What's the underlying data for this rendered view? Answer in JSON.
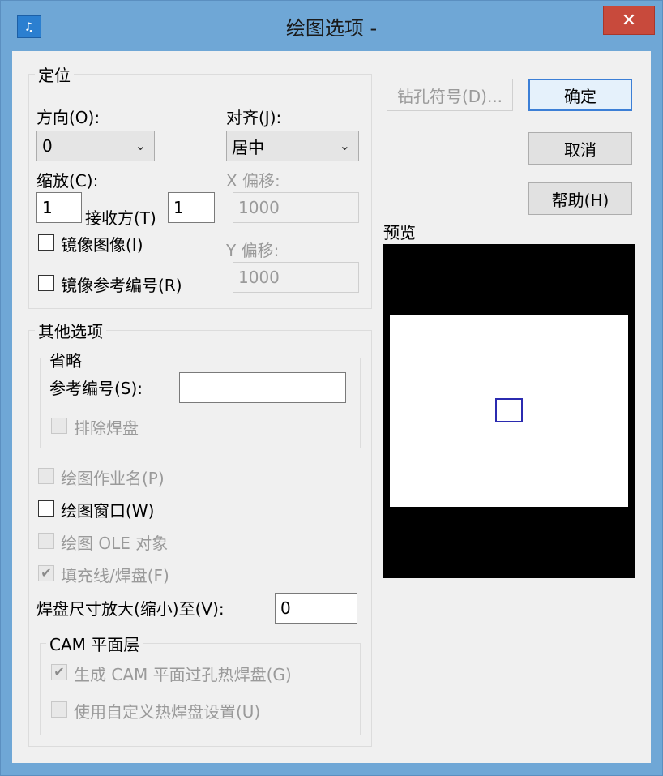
{
  "window": {
    "title": "绘图选项 -",
    "close_symbol": "✕",
    "app_icon": "pcb-app-icon"
  },
  "positioning": {
    "group_label": "定位",
    "orientation_label": "方向(O):",
    "orientation_value": "0",
    "align_label": "对齐(J):",
    "align_value": "居中",
    "scale_label": "缩放(C):",
    "scale_value": "1",
    "receive_label": "接收方(T)",
    "receive_value": "1",
    "x_offset_label": "X 偏移:",
    "x_offset_value": "1000",
    "y_offset_label": "Y 偏移:",
    "y_offset_value": "1000",
    "mirror_image_label": "镜像图像(I)",
    "mirror_refdes_label": "镜像参考编号(R)"
  },
  "other": {
    "group_label": "其他选项",
    "omit_group_label": "省略",
    "refdes_label": "参考编号(S):",
    "refdes_value": "",
    "exclude_pads_label": "排除焊盘",
    "plot_job_name_label": "绘图作业名(P)",
    "plot_window_label": "绘图窗口(W)",
    "plot_ole_label": "绘图 OLE 对象",
    "fill_label": "填充线/焊盘(F)",
    "fill_checked": "✔",
    "pad_scale_label": "焊盘尺寸放大(缩小)至(V):",
    "pad_scale_value": "0",
    "cam_group_label": "CAM 平面层",
    "cam_generate_label": "生成 CAM 平面过孔热焊盘(G)",
    "cam_generate_checked": "✔",
    "cam_custom_label": "使用自定义热焊盘设置(U)"
  },
  "buttons": {
    "drill_label": "钻孔符号(D)...",
    "ok_label": "确定",
    "cancel_label": "取消",
    "help_label": "帮助(H)"
  },
  "preview": {
    "label": "预览",
    "background": "#000000",
    "board_color": "#ffffff",
    "pad_color": "#2b2bb0"
  }
}
